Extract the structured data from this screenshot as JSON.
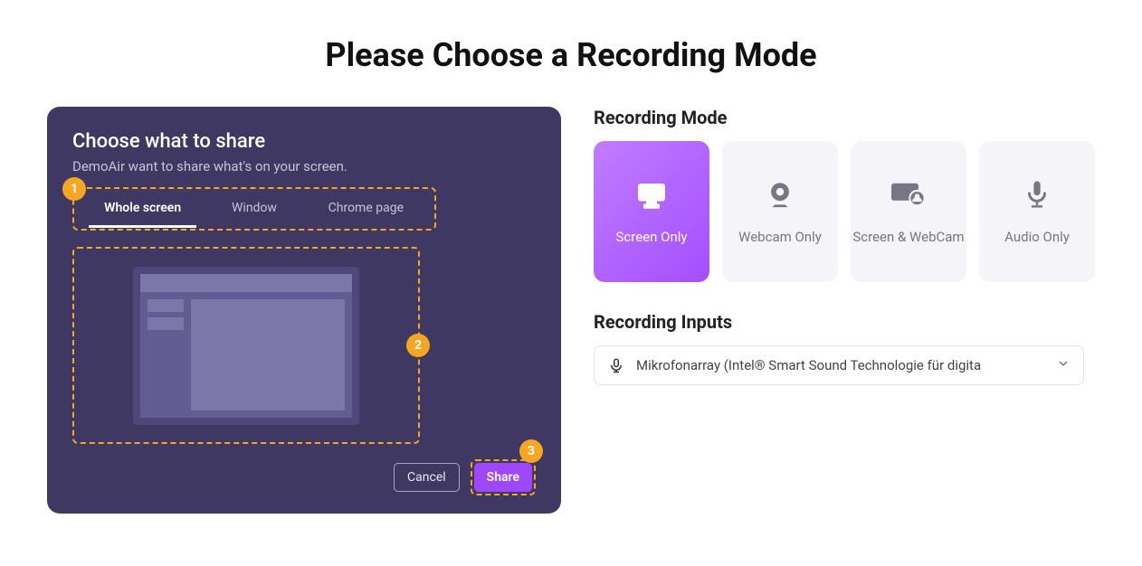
{
  "title": "Please Choose a Recording Mode",
  "share_panel": {
    "heading": "Choose what to share",
    "subheading": "DemoAir want to share what's on your screen.",
    "tabs": [
      "Whole screen",
      "Window",
      "Chrome page"
    ],
    "badges": {
      "one": "1",
      "two": "2",
      "three": "3"
    },
    "cancel_label": "Cancel",
    "share_label": "Share"
  },
  "right": {
    "mode_section_title": "Recording Mode",
    "modes": [
      {
        "label": "Screen Only",
        "icon": "monitor-icon",
        "active": true
      },
      {
        "label": "Webcam Only",
        "icon": "webcam-icon",
        "active": false
      },
      {
        "label": "Screen & WebCam",
        "icon": "screen-webcam-icon",
        "active": false
      },
      {
        "label": "Audio Only",
        "icon": "microphone-icon",
        "active": false
      }
    ],
    "inputs_section_title": "Recording Inputs",
    "mic_input_value": "Mikrofonarray (Intel® Smart Sound Technologie für digita"
  }
}
